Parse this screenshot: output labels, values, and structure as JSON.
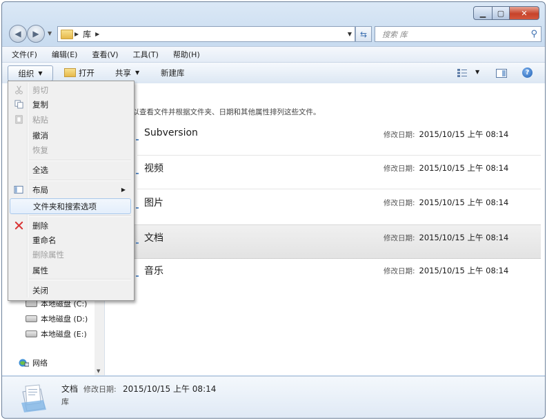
{
  "window": {
    "caption_buttons": [
      "minimize",
      "maximize",
      "close"
    ]
  },
  "address": {
    "crumb": "库",
    "search_placeholder": "搜索 库"
  },
  "menubar": {
    "items": [
      "文件(F)",
      "编辑(E)",
      "查看(V)",
      "工具(T)",
      "帮助(H)"
    ]
  },
  "toolbar": {
    "organize": "组织",
    "open": "打开",
    "share": "共享",
    "new_library": "新建库"
  },
  "main": {
    "info_text": "库以查看文件并根据文件夹、日期和其他属性排列这些文件。",
    "date_label": "修改日期:",
    "libraries": [
      {
        "name": "Subversion",
        "date": "2015/10/15 上午 08:14"
      },
      {
        "name": "视频",
        "date": "2015/10/15 上午 08:14"
      },
      {
        "name": "图片",
        "date": "2015/10/15 上午 08:14"
      },
      {
        "name": "文档",
        "date": "2015/10/15 上午 08:14"
      },
      {
        "name": "音乐",
        "date": "2015/10/15 上午 08:14"
      }
    ],
    "selected_index": 3
  },
  "navpane": {
    "partial_drive": "本地磁盘 (C:)",
    "drive_d": "本地磁盘 (D:)",
    "drive_e": "本地磁盘 (E:)",
    "network": "网络"
  },
  "context_menu": {
    "items": [
      {
        "label": "剪切",
        "enabled": false,
        "icon": "scissors-icon"
      },
      {
        "label": "复制",
        "enabled": true,
        "icon": "copy-icon"
      },
      {
        "label": "粘贴",
        "enabled": false,
        "icon": "paste-icon"
      },
      {
        "label": "撤消",
        "enabled": true
      },
      {
        "label": "恢复",
        "enabled": false
      },
      {
        "label": "全选",
        "enabled": true
      },
      {
        "label": "布局",
        "enabled": true,
        "icon": "layout-icon",
        "submenu": true
      },
      {
        "label": "文件夹和搜索选项",
        "enabled": true,
        "highlighted": true
      },
      {
        "label": "删除",
        "enabled": true,
        "icon": "delete-x-icon"
      },
      {
        "label": "重命名",
        "enabled": true
      },
      {
        "label": "删除属性",
        "enabled": false
      },
      {
        "label": "属性",
        "enabled": true
      },
      {
        "label": "关闭",
        "enabled": true
      }
    ]
  },
  "details": {
    "name": "文档",
    "date_label": "修改日期:",
    "date": "2015/10/15 上午 08:14",
    "type": "库"
  },
  "colors": {
    "frame": "#c9dcf0",
    "close_button": "#c7432a",
    "selection": "#e3e3e3",
    "menu_highlight": "#e3eefb",
    "delete_icon": "#d93636"
  }
}
